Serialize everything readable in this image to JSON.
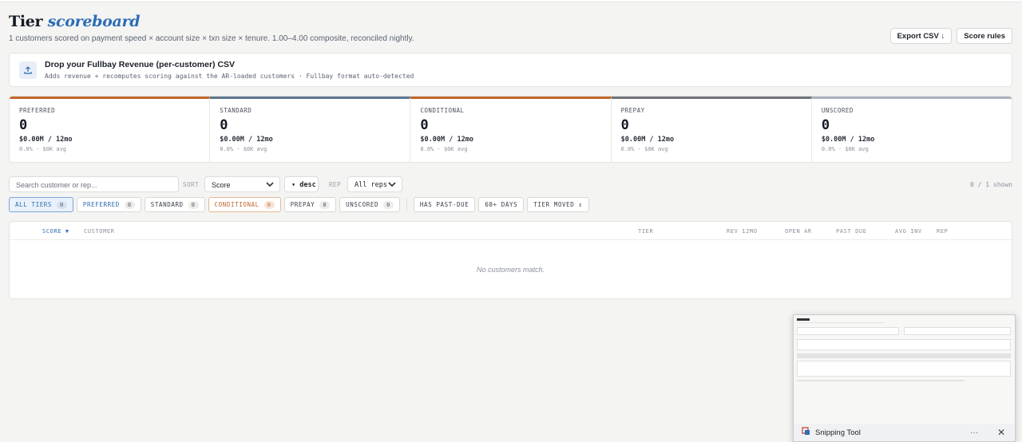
{
  "header": {
    "title_plain": "Tier",
    "title_accent": "scoreboard",
    "subtitle": "1 customers scored on payment speed × account size × txn size × tenure. 1.00–4.00 composite, reconciled nightly.",
    "export_label": "Export CSV ↓",
    "rules_label": "Score rules"
  },
  "upload": {
    "icon": "upload-icon",
    "title": "Drop your Fullbay Revenue (per-customer) CSV",
    "description": "Adds revenue + recomputes scoring against the AR-loaded customers · Fullbay format auto-detected"
  },
  "tiers": [
    {
      "name": "PREFERRED",
      "count": "0",
      "revenue": "$0.00M / 12mo",
      "avg": "0.0% · $0K avg",
      "color": "#c2662d"
    },
    {
      "name": "STANDARD",
      "count": "0",
      "revenue": "$0.00M / 12mo",
      "avg": "0.0% · $0K avg",
      "color": "#5e7590"
    },
    {
      "name": "CONDITIONAL",
      "count": "0",
      "revenue": "$0.00M / 12mo",
      "avg": "0.0% · $0K avg",
      "color": "#c2662d"
    },
    {
      "name": "PREPAY",
      "count": "0",
      "revenue": "$0.00M / 12mo",
      "avg": "0.0% · $0K avg",
      "color": "#6f7378"
    },
    {
      "name": "UNSCORED",
      "count": "0",
      "revenue": "$0.00M / 12mo",
      "avg": "0.0% · $0K avg",
      "color": "#a9b4bf"
    }
  ],
  "filters": {
    "search_placeholder": "Search customer or rep...",
    "sort_label": "SORT",
    "sort_value": "Score",
    "order_value": "▾ desc",
    "rep_label": "REP",
    "rep_value": "All reps",
    "shown": "0 / 1 shown"
  },
  "chips": {
    "all": {
      "label": "ALL TIERS",
      "count": "0"
    },
    "preferred": {
      "label": "PREFERRED",
      "count": "0"
    },
    "standard": {
      "label": "STANDARD",
      "count": "0"
    },
    "conditional": {
      "label": "CONDITIONAL",
      "count": "0"
    },
    "prepay": {
      "label": "PREPAY",
      "count": "0"
    },
    "unscored": {
      "label": "UNSCORED",
      "count": "0"
    },
    "past_due": "HAS PAST-DUE",
    "sixty_days": "60+ DAYS",
    "tier_moved": "TIER MOVED ↕"
  },
  "table": {
    "columns": {
      "score": "SCORE ▼",
      "customer": "CUSTOMER",
      "tier": "TIER",
      "rev": "REV 12MO",
      "open_ar": "OPEN AR",
      "past_due": "PAST DUE",
      "avg_inv": "AVG INV",
      "rep": "REP"
    },
    "empty_message": "No customers match."
  },
  "snipping_tool": {
    "title": "Snipping Tool",
    "more": "···",
    "close": "✕"
  }
}
